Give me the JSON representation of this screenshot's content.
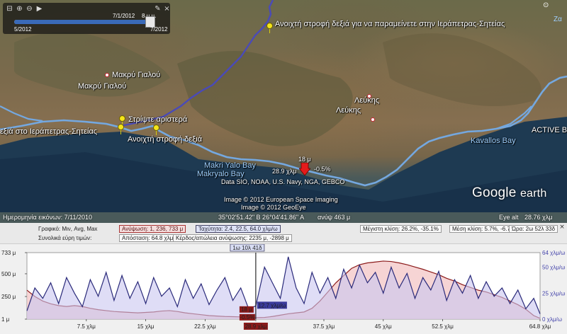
{
  "map": {
    "labels": {
      "turn_right_ierapetra": "Ανοιχτή στροφή δεξιά για να παραμείνετε στην Ιεράπετρας-Σητείας",
      "makry_gialou_1": "Μακρύ Γιαλού",
      "makry_gialou_2": "Μακρύ Γιαλού",
      "turn_left": "Στρίψτε αριστερά",
      "turn_right": "Ανοιχτή στροφή δεξιά",
      "ierapetra_road": "εξιά στο Ιεράπετρας-Σητείας",
      "lefkis_1": "Λεύκης",
      "lefkis_2": "Λεύκης",
      "kavallos_bay": "Kavallos Bay",
      "active": "ACTIVE B",
      "makri_yalo_bay": "Makri Yalo Bay",
      "makryalo_bay": "Makryalo Bay",
      "cursor_elev": "18 μ",
      "cursor_dist": "28.9 χλμ",
      "cursor_slope": "-0.5%",
      "data_credit": "Data SIO, NOAA, U.S. Navy, NGA, GEBCO",
      "image_credit_1": "Image © 2012 European Space Imaging",
      "image_credit_2": "Image © 2012 GeoEye",
      "zoom_tag": "Ζα"
    },
    "time_slider": {
      "date_top": "7/1/2012",
      "time_top": "8 μ.μ.",
      "date_start": "5/2012",
      "date_end": "7/2012"
    },
    "logo": {
      "google": "Google",
      "earth": "earth"
    },
    "status": {
      "imagery_date": "Ημερομηνία εικόνων: 7/11/2010",
      "coords": "35°02'51.42\" Β  26°04'41.86\" Α",
      "elev": "ανύψ  463 μ",
      "eye_alt_label": "Eye alt",
      "eye_alt": "28.76 χλμ"
    }
  },
  "profile": {
    "row1": {
      "graph_label": "Γραφικό: Μιν, Avg, Max",
      "elevation": "Ανύψωση: 1, 236, 733 μ",
      "speed": "Ταχύτητα: 2.4, 22.5, 64.0 χλμ/ω",
      "max_slope": "Μέγιστη κλίση: 26.2%, -35.1%",
      "avg_slope": "Μέση κλίση: 5.7%, -6.7%",
      "time": "Ώρα: 2ω 52λ 33δ"
    },
    "row2": {
      "ranges_label": "Συνολικά εύρη τιμών:",
      "distance": "Απόσταση: 64.8 χλμ",
      "gain": "Κέρδος/απώλεια ανύψωσης: 2235 μ, -2898 μ"
    },
    "close_icon": "×"
  },
  "chart_data": {
    "type": "area",
    "x_unit": "χλμ",
    "xlim": [
      0,
      64.8
    ],
    "ylim": [
      1,
      733
    ],
    "y2lim": [
      0,
      64
    ],
    "y_ticks": [
      "733 μ",
      "500 μ",
      "250 μ",
      "1 μ"
    ],
    "y2_ticks": [
      "64 χλμ/ω",
      "50 χλμ/ω",
      "25 χλμ/ω",
      "0 χλμ/ω"
    ],
    "x_ticks": [
      "7.5 χλμ",
      "15 χλμ",
      "22.5 χλμ",
      "28.9 χλμ",
      "37.5 χλμ",
      "45 χλμ",
      "52.5 χλμ",
      "64.8 χλμ"
    ],
    "x_tick_values": [
      7.5,
      15,
      22.5,
      28.9,
      37.5,
      45,
      52.5,
      64.8
    ],
    "cursor": {
      "x": 28.9,
      "time_label": "1ω 10λ 41δ",
      "elev_label": "18 μ",
      "slope_label": "-0.5%",
      "speed_label": "12.7 χλμ/ω",
      "dist_label": "28.9 χλμ"
    },
    "series": [
      {
        "name": "Ανύψωση",
        "axis": "left",
        "color": "#8b1a1a",
        "fill": "#f3c6c6",
        "x": [
          0,
          1,
          2,
          3,
          4,
          5,
          6,
          7,
          8,
          9,
          10,
          11,
          12,
          13,
          14,
          15,
          16,
          17,
          18,
          19,
          20,
          21,
          22,
          23,
          24,
          25,
          26,
          27,
          28,
          28.9,
          30,
          31,
          32,
          33,
          34,
          35,
          36,
          37,
          38,
          39,
          40,
          41,
          42,
          43,
          44,
          45,
          46,
          47,
          48,
          49,
          50,
          51,
          52,
          53,
          54,
          55,
          56,
          57,
          58,
          59,
          60,
          61,
          62,
          63,
          64,
          64.8
        ],
        "values": [
          320,
          250,
          200,
          170,
          150,
          140,
          150,
          140,
          120,
          105,
          95,
          85,
          80,
          75,
          70,
          75,
          80,
          90,
          95,
          85,
          70,
          60,
          50,
          40,
          35,
          30,
          28,
          26,
          22,
          18,
          20,
          30,
          45,
          60,
          70,
          80,
          120,
          200,
          300,
          400,
          480,
          560,
          600,
          620,
          630,
          640,
          635,
          620,
          600,
          575,
          550,
          520,
          490,
          450,
          420,
          380,
          350,
          320,
          300,
          270,
          240,
          200,
          160,
          110,
          40,
          10
        ]
      },
      {
        "name": "Ταχύτητα",
        "axis": "right",
        "color": "#2a2a7a",
        "fill": "#c9c6f0",
        "x": [
          0,
          1,
          2,
          3,
          4,
          5,
          6,
          7,
          8,
          9,
          10,
          11,
          12,
          13,
          14,
          15,
          16,
          17,
          18,
          19,
          20,
          21,
          22,
          23,
          24,
          25,
          26,
          27,
          28,
          28.9,
          30,
          31,
          32,
          33,
          34,
          35,
          36,
          37,
          38,
          39,
          40,
          41,
          42,
          43,
          44,
          45,
          46,
          47,
          48,
          49,
          50,
          51,
          52,
          53,
          54,
          55,
          56,
          57,
          58,
          59,
          60,
          61,
          62,
          63,
          64,
          64.8
        ],
        "values": [
          8,
          30,
          20,
          35,
          15,
          40,
          25,
          12,
          38,
          22,
          45,
          18,
          42,
          20,
          36,
          15,
          40,
          22,
          30,
          12,
          38,
          20,
          34,
          14,
          28,
          40,
          18,
          30,
          10,
          12.7,
          50,
          35,
          20,
          60,
          30,
          15,
          45,
          25,
          40,
          20,
          48,
          30,
          52,
          35,
          45,
          25,
          50,
          30,
          44,
          20,
          40,
          28,
          46,
          18,
          38,
          25,
          42,
          20,
          36,
          22,
          30,
          15,
          28,
          10,
          20,
          5
        ]
      }
    ]
  }
}
